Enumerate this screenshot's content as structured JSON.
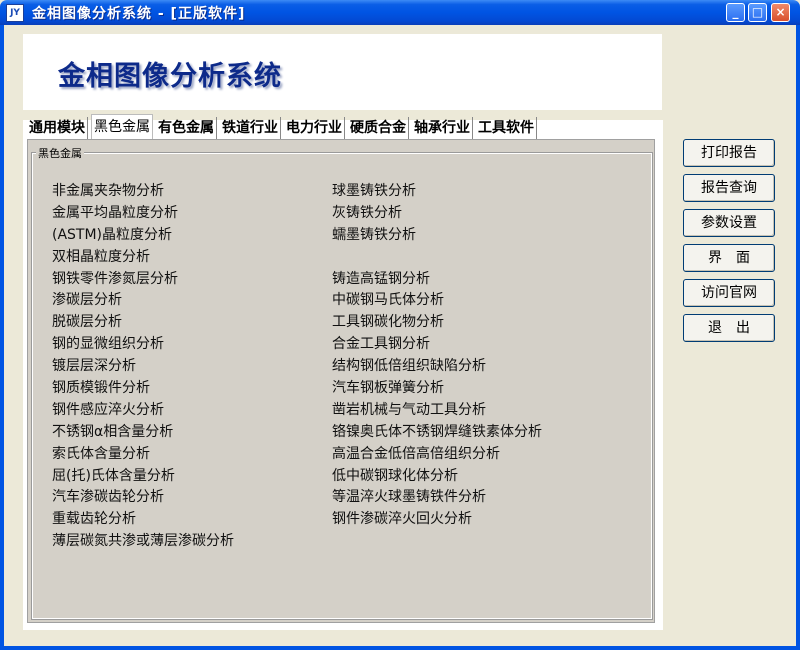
{
  "window": {
    "title": "金相图像分析系统 - [正版软件]",
    "icon_text": "JY"
  },
  "banner": {
    "title": "金相图像分析系统"
  },
  "tabs": [
    {
      "label": "通用模块"
    },
    {
      "label": "黑色金属",
      "active": true
    },
    {
      "label": "有色金属"
    },
    {
      "label": "铁道行业"
    },
    {
      "label": "电力行业"
    },
    {
      "label": "硬质合金"
    },
    {
      "label": "轴承行业"
    },
    {
      "label": "工具软件"
    }
  ],
  "group": {
    "label": "黑色金属",
    "left_items": [
      "非金属夹杂物分析",
      "金属平均晶粒度分析",
      "(ASTM)晶粒度分析",
      "双相晶粒度分析",
      "钢铁零件渗氮层分析",
      "渗碳层分析",
      "脱碳层分析",
      "钢的显微组织分析",
      "镀层层深分析",
      "钢质模锻件分析",
      "钢件感应淬火分析",
      "不锈钢α相含量分析",
      "索氏体含量分析",
      "屈(托)氏体含量分析",
      "汽车渗碳齿轮分析",
      "重载齿轮分析",
      "薄层碳氮共渗或薄层渗碳分析"
    ],
    "right_items": [
      "球墨铸铁分析",
      "灰铸铁分析",
      "蠕墨铸铁分析",
      "",
      "铸造高锰钢分析",
      "中碳钢马氏体分析",
      "工具钢碳化物分析",
      "合金工具钢分析",
      "结构钢低倍组织缺陷分析",
      "汽车钢板弹簧分析",
      "凿岩机械与气动工具分析",
      "铬镍奥氏体不锈钢焊缝铁素体分析",
      "高温合金低倍高倍组织分析",
      "低中碳钢球化体分析",
      "等温淬火球墨铸铁件分析",
      "钢件渗碳淬火回火分析"
    ]
  },
  "buttons": [
    {
      "label": "打印报告"
    },
    {
      "label": "报告查询"
    },
    {
      "label": "参数设置"
    },
    {
      "label": "界　面"
    },
    {
      "label": "访问官网"
    },
    {
      "label": "退　出"
    }
  ],
  "window_controls": {
    "minimize": "_",
    "maximize": "□",
    "close": "×"
  },
  "colors": {
    "titlebar": "#0054e3",
    "banner_title": "#0d2a8a",
    "tab_body": "#d4d0c8",
    "window_bg": "#ece9d8"
  }
}
